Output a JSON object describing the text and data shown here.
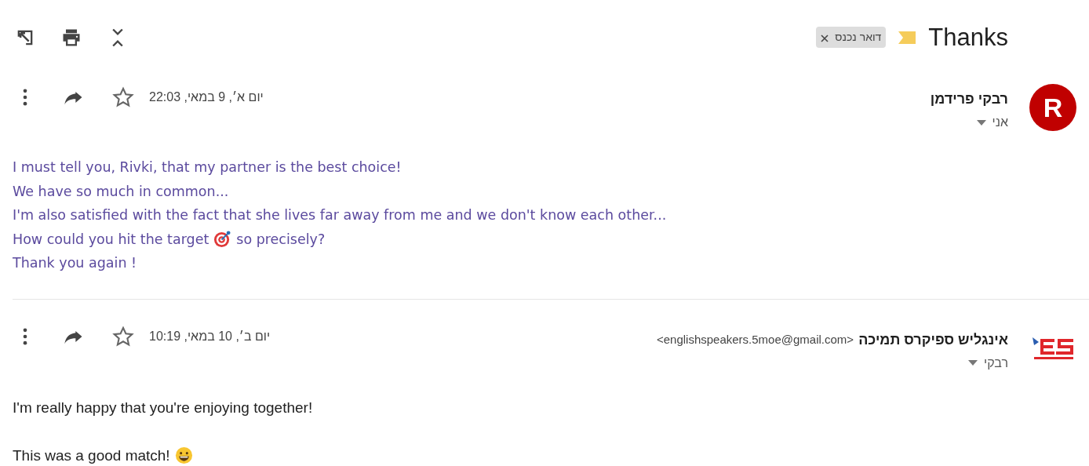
{
  "toolbar": [
    {
      "kind": "open-new-window"
    },
    {
      "kind": "print"
    },
    {
      "kind": "expand-collapse"
    }
  ],
  "subject": {
    "title": "Thanks",
    "important": true,
    "labels": [
      {
        "text": "דואר נכנס",
        "removable": true
      }
    ]
  },
  "messages": [
    {
      "sender": "רבקי פרידמן",
      "avatar": {
        "kind": "letter",
        "letter": "R"
      },
      "recipient": "אני",
      "date": "יום א׳, 9 במאי, 22:03",
      "starred": false,
      "color": "#5b4a9e",
      "body": [
        {
          "text": "I must tell you, Rivki, that my partner is the best choice!"
        },
        {
          "text": "We have so much in common..."
        },
        {
          "text": "I'm also satisfied with the fact that she lives far away from me and we don't know each other..."
        },
        {
          "text": "How could you hit the target",
          "kind": "target",
          "after": "so precisely?"
        },
        {
          "text": "Thank you again !"
        }
      ]
    },
    {
      "sender": "אינגליש ספיקרס תמיכה",
      "email": "<englishspeakers.5moe@gmail.com>",
      "avatar": {
        "kind": "logo"
      },
      "recipient": "רבקי",
      "date": "יום ב׳, 10 במאי, 10:19",
      "starred": false,
      "color": "#222222",
      "body": [
        {
          "text": "I'm really happy that you're enjoying together!"
        },
        {
          "kind": "blank"
        },
        {
          "text": "This was a good match!",
          "kind": "smile"
        }
      ]
    }
  ]
}
